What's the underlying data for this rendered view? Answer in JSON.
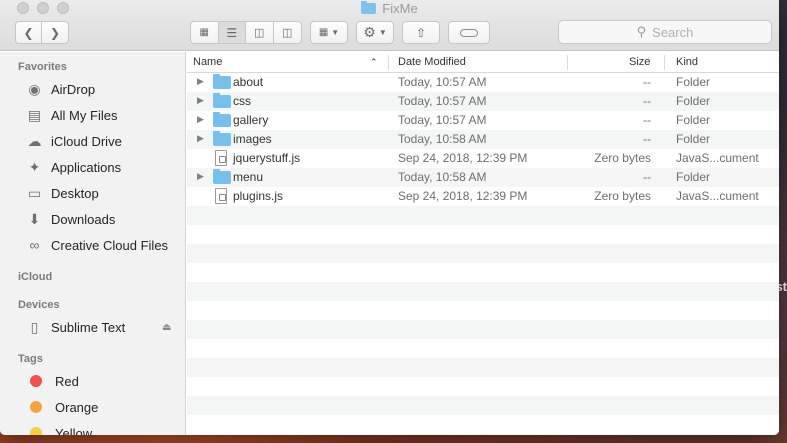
{
  "window": {
    "title": "FixMe"
  },
  "toolbar": {
    "search_placeholder": "Search"
  },
  "sidebar": {
    "favorites_label": "Favorites",
    "favorites": [
      {
        "label": "AirDrop",
        "icon": "airdrop-icon"
      },
      {
        "label": "All My Files",
        "icon": "all-files-icon"
      },
      {
        "label": "iCloud Drive",
        "icon": "cloud-icon"
      },
      {
        "label": "Applications",
        "icon": "applications-icon"
      },
      {
        "label": "Desktop",
        "icon": "desktop-icon"
      },
      {
        "label": "Downloads",
        "icon": "downloads-icon"
      },
      {
        "label": "Creative Cloud Files",
        "icon": "creative-cloud-icon"
      }
    ],
    "icloud_label": "iCloud",
    "devices_label": "Devices",
    "devices": [
      {
        "label": "Sublime Text",
        "icon": "disk-icon"
      }
    ],
    "tags_label": "Tags",
    "tags": [
      {
        "label": "Red",
        "color": "#f2504b"
      },
      {
        "label": "Orange",
        "color": "#f7a33b"
      },
      {
        "label": "Yellow",
        "color": "#f5cf3d"
      }
    ]
  },
  "columns": {
    "name": "Name",
    "date": "Date Modified",
    "size": "Size",
    "kind": "Kind"
  },
  "files": [
    {
      "name": "about",
      "date": "Today, 10:57 AM",
      "size": "--",
      "kind": "Folder",
      "type": "folder"
    },
    {
      "name": "css",
      "date": "Today, 10:57 AM",
      "size": "--",
      "kind": "Folder",
      "type": "folder"
    },
    {
      "name": "gallery",
      "date": "Today, 10:57 AM",
      "size": "--",
      "kind": "Folder",
      "type": "folder"
    },
    {
      "name": "images",
      "date": "Today, 10:58 AM",
      "size": "--",
      "kind": "Folder",
      "type": "folder"
    },
    {
      "name": "jquerystuff.js",
      "date": "Sep 24, 2018, 12:39 PM",
      "size": "Zero bytes",
      "kind": "JavaS...cument",
      "type": "file"
    },
    {
      "name": "menu",
      "date": "Today, 10:58 AM",
      "size": "--",
      "kind": "Folder",
      "type": "folder"
    },
    {
      "name": "plugins.js",
      "date": "Sep 24, 2018, 12:39 PM",
      "size": "Zero bytes",
      "kind": "JavaS...cument",
      "type": "file"
    }
  ],
  "desktop": {
    "partial_text": "st"
  }
}
